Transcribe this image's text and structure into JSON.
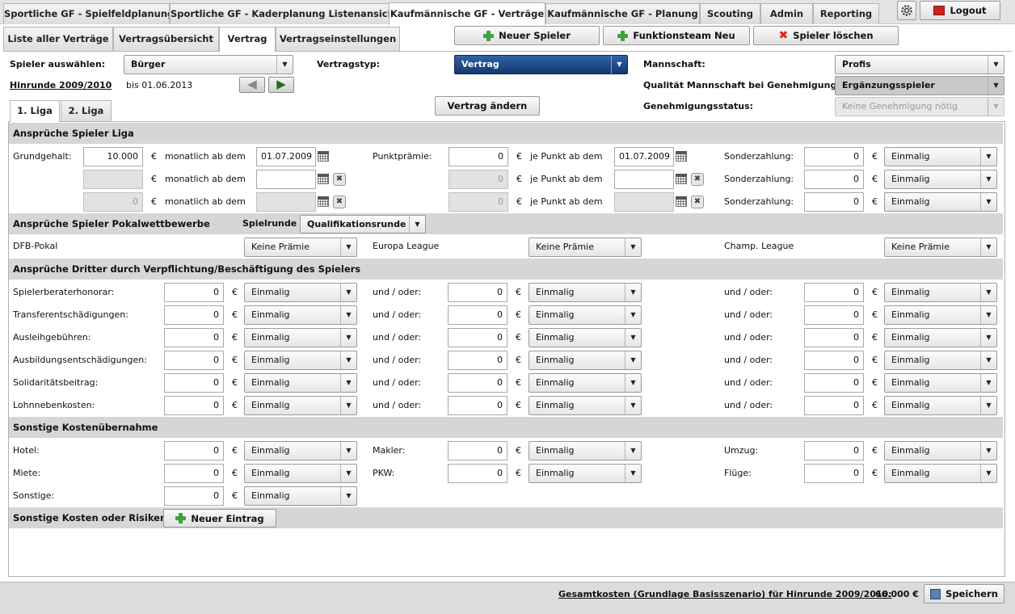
{
  "top_tabs": [
    {
      "label": "Sportliche GF - Spielfeldplanung"
    },
    {
      "label": "Sportliche GF - Kaderplanung Listenansicht"
    },
    {
      "label": "Kaufmännische GF - Verträge"
    },
    {
      "label": "Kaufmännische GF - Planung"
    },
    {
      "label": "Scouting"
    },
    {
      "label": "Admin"
    },
    {
      "label": "Reporting"
    }
  ],
  "logout_label": "Logout",
  "sub_tabs": [
    {
      "label": "Liste aller Verträge"
    },
    {
      "label": "Vertragsübersicht"
    },
    {
      "label": "Vertrag"
    },
    {
      "label": "Vertragseinstellungen"
    }
  ],
  "actions": {
    "new_player": "Neuer Spieler",
    "new_staff": "Funktionsteam Neu",
    "delete_player": "Spieler löschen"
  },
  "header": {
    "select_player_label": "Spieler auswählen:",
    "player": "Bürger",
    "period_link": "Hinrunde 2009/2010",
    "until": "bis 01.06.2013",
    "contract_type_label": "Vertragstyp:",
    "contract_type": "Vertrag",
    "change_contract": "Vertrag ändern",
    "team_label": "Mannschaft:",
    "team": "Profis",
    "quality_label": "Qualität Mannschaft bei Genehmigung:",
    "quality": "Ergänzungsspieler",
    "approval_label": "Genehmigungsstatus:",
    "approval": "Keine Genehmigung nötig"
  },
  "league_tabs": [
    "1. Liga",
    "2. Liga"
  ],
  "sections": {
    "claims_league": "Ansprüche Spieler Liga",
    "claims_cup": "Ansprüche Spieler Pokalwettbewerbe",
    "round_label": "Spielrunde",
    "round_value": "Qualifikationsrunde",
    "third_party": "Ansprüche Dritter durch Verpflichtung/Beschäftigung des Spielers",
    "other_costs": "Sonstige Kostenübernahme",
    "other_risks": "Sonstige Kosten oder Risiken",
    "new_entry": "Neuer Eintrag"
  },
  "labels": {
    "base_salary": "Grundgehalt:",
    "monthly_from": "monatlich ab dem",
    "point_bonus": "Punktprämie:",
    "per_point_from": "je Punkt ab dem",
    "special_payment": "Sonderzahlung:",
    "and_or": "und / oder:",
    "currency": "€"
  },
  "league_rows": [
    {
      "salary": "10.000",
      "salary_date": "01.07.2009",
      "bonus": "0",
      "bonus_date": "01.07.2009",
      "special": "0",
      "freq": "Einmalig"
    },
    {
      "salary": "",
      "salary_date": "",
      "bonus": "0",
      "bonus_date": "",
      "special": "0",
      "freq": "Einmalig"
    },
    {
      "salary": "0",
      "salary_date": "",
      "bonus": "0",
      "bonus_date": "",
      "special": "0",
      "freq": "Einmalig"
    }
  ],
  "cups": [
    {
      "label": "DFB-Pokal",
      "value": "Keine Prämie"
    },
    {
      "label": "Europa League",
      "value": "Keine Prämie"
    },
    {
      "label": "Champ. League",
      "value": "Keine Prämie"
    }
  ],
  "third_party_rows": [
    {
      "label": "Spielerberaterhonorar:",
      "v1": "0",
      "f1": "Einmalig",
      "v2": "0",
      "f2": "Einmalig",
      "v3": "0",
      "f3": "Einmalig"
    },
    {
      "label": "Transferentschädigungen:",
      "v1": "0",
      "f1": "Einmalig",
      "v2": "0",
      "f2": "Einmalig",
      "v3": "0",
      "f3": "Einmalig"
    },
    {
      "label": "Ausleihgebühren:",
      "v1": "0",
      "f1": "Einmalig",
      "v2": "0",
      "f2": "Einmalig",
      "v3": "0",
      "f3": "Einmalig"
    },
    {
      "label": "Ausbildungsentschädigungen:",
      "v1": "0",
      "f1": "Einmalig",
      "v2": "0",
      "f2": "Einmalig",
      "v3": "0",
      "f3": "Einmalig"
    },
    {
      "label": "Solidaritätsbeitrag:",
      "v1": "0",
      "f1": "Einmalig",
      "v2": "0",
      "f2": "Einmalig",
      "v3": "0",
      "f3": "Einmalig"
    },
    {
      "label": "Lohnnebenkosten:",
      "v1": "0",
      "f1": "Einmalig",
      "v2": "0",
      "f2": "Einmalig",
      "v3": "0",
      "f3": "Einmalig"
    }
  ],
  "other_cost_rows": [
    [
      {
        "label": "Hotel:",
        "value": "0",
        "freq": "Einmalig"
      },
      {
        "label": "Makler:",
        "value": "0",
        "freq": "Einmalig"
      },
      {
        "label": "Umzug:",
        "value": "0",
        "freq": "Einmalig"
      }
    ],
    [
      {
        "label": "Miete:",
        "value": "0",
        "freq": "Einmalig"
      },
      {
        "label": "PKW:",
        "value": "0",
        "freq": "Einmalig"
      },
      {
        "label": "Flüge:",
        "value": "0",
        "freq": "Einmalig"
      }
    ],
    [
      {
        "label": "Sonstige:",
        "value": "0",
        "freq": "Einmalig"
      }
    ]
  ],
  "footer": {
    "total_label": "Gesamtkosten (Grundlage Basisszenario) für Hinrunde 2009/2010:",
    "total_value": "66.000 €",
    "save": "Speichern"
  },
  "icons": [
    "settings-gear-icon",
    "logout-icon",
    "plus-icon",
    "delete-x-icon",
    "calendar-icon",
    "clear-icon",
    "arrow-left-icon",
    "arrow-right-icon",
    "save-disk-icon",
    "dropdown-arrow-icon"
  ],
  "colors": {
    "accent_blue": "#1f4a8a",
    "plus_green": "#3fa33c",
    "delete_red": "#d22222",
    "section_gray": "#d6d6d6"
  }
}
